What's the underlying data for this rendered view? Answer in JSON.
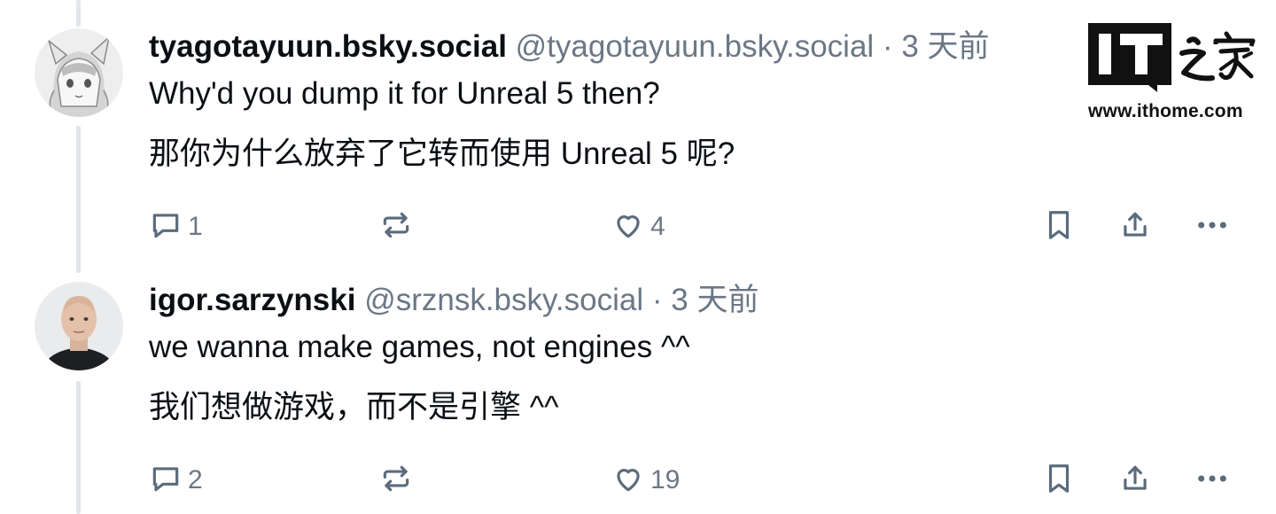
{
  "posts": [
    {
      "display_name": "tyagotayuun.bsky.social",
      "handle": "@tyagotayuun.bsky.social",
      "separator": " · ",
      "time": "3 天前",
      "text": "Why'd you dump it for Unreal 5 then?",
      "translation": "那你为什么放弃了它转而使用 Unreal 5 呢?",
      "reply_count": "1",
      "like_count": "4"
    },
    {
      "display_name": "igor.sarzynski",
      "handle": "@srznsk.bsky.social",
      "separator": " · ",
      "time": "3 天前",
      "text": "we wanna make games, not engines ^^",
      "translation": "我们想做游戏，而不是引擎 ^^",
      "reply_count": "2",
      "like_count": "19"
    }
  ],
  "watermark": {
    "logo_text": "IT之家",
    "url": "www.ithome.com"
  },
  "icons": {
    "reply": "comment-bubble-icon",
    "repost": "repost-icon",
    "like": "heart-icon",
    "bookmark": "bookmark-icon",
    "share": "share-icon",
    "more": "more-dots-icon"
  },
  "colors": {
    "text": "#0b0f14",
    "muted": "#6b7785",
    "icon": "#5b6b7c",
    "thread_line": "#e2e6ea"
  }
}
